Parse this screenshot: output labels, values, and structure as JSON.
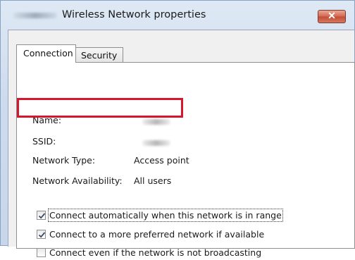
{
  "window": {
    "title": "Wireless Network properties",
    "close_label": "✕",
    "close_color": "#c8543b",
    "highlight_color": "#d6162c"
  },
  "tabs": [
    {
      "label": "Connection",
      "selected": true
    },
    {
      "label": "Security",
      "selected": false
    }
  ],
  "fields": {
    "name_label": "Name:",
    "ssid_label": "SSID:",
    "network_type_label": "Network Type:",
    "network_type_value": "Access point",
    "availability_label": "Network Availability:",
    "availability_value": "All users"
  },
  "options": [
    {
      "label": "Connect automatically when this network is in range",
      "checked": true,
      "focused": true
    },
    {
      "label": "Connect to a more preferred network if available",
      "checked": true,
      "focused": false
    },
    {
      "label": "Connect even if the network is not broadcasting",
      "checked": false,
      "focused": false
    }
  ]
}
